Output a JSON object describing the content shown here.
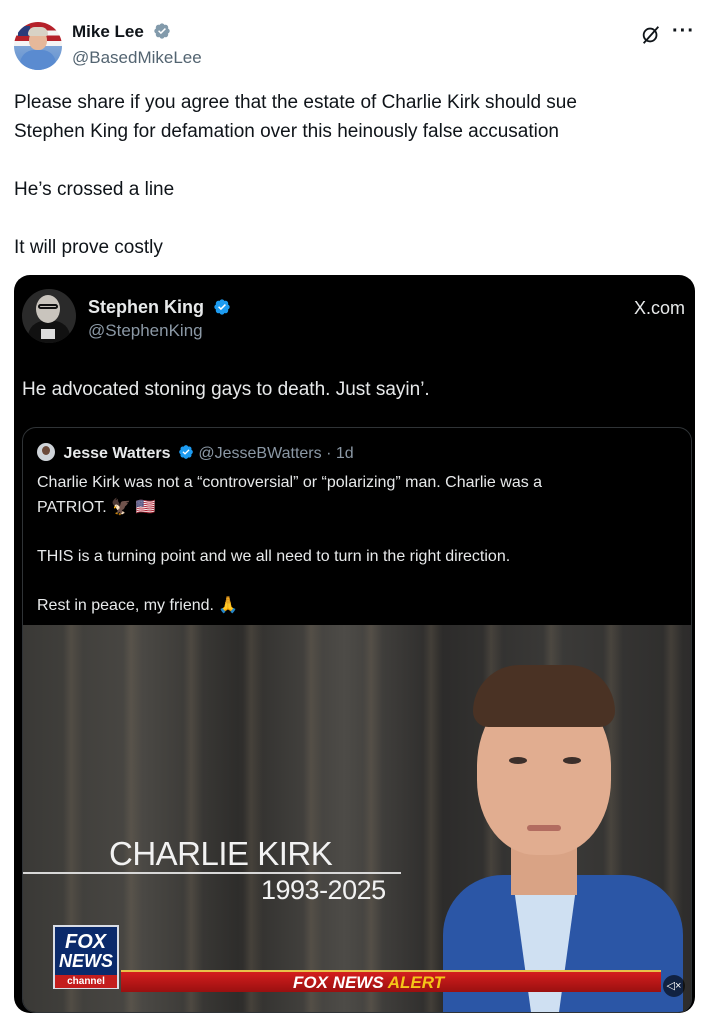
{
  "post": {
    "author_name": "Mike Lee",
    "author_handle": "@BasedMikeLee",
    "more_label": "···",
    "text_lines": [
      "Please share if you agree that the estate of Charlie Kirk should sue",
      "Stephen King for defamation over this heinously false accusation",
      "He’s crossed a line",
      "It will prove costly"
    ]
  },
  "embed": {
    "author_name": "Stephen King",
    "author_handle": "@StephenKing",
    "source_label": "X.com",
    "text": "He advocated stoning gays to death. Just sayin’.",
    "quote": {
      "author_name": "Jesse Watters",
      "handle_time": "@JesseBWatters · 1d",
      "lines": [
        "Charlie Kirk was not a “controversial” or “polarizing” man. Charlie was a",
        "PATRIOT. 🦅 🇺🇸",
        "THIS is a turning point and we all need to turn in the right direction.",
        "Rest in peace, my friend. 🙏"
      ]
    },
    "video": {
      "lower_third_name": "CHARLIE KIRK",
      "lower_third_years": "1993-2025",
      "logo_line1": "FOX",
      "logo_line2": "NEWS",
      "logo_line3": "channel",
      "alert_prefix": "FOX NEWS ",
      "alert_highlight": "ALERT",
      "mute_label": "◁×"
    }
  },
  "colors": {
    "verified": "#1d9bf0",
    "text_primary": "#0f1419",
    "text_secondary": "#536471",
    "card_bg": "#000000"
  },
  "icons": [
    "verified-badge-icon",
    "grok-icon",
    "more-icon",
    "mute-icon"
  ]
}
